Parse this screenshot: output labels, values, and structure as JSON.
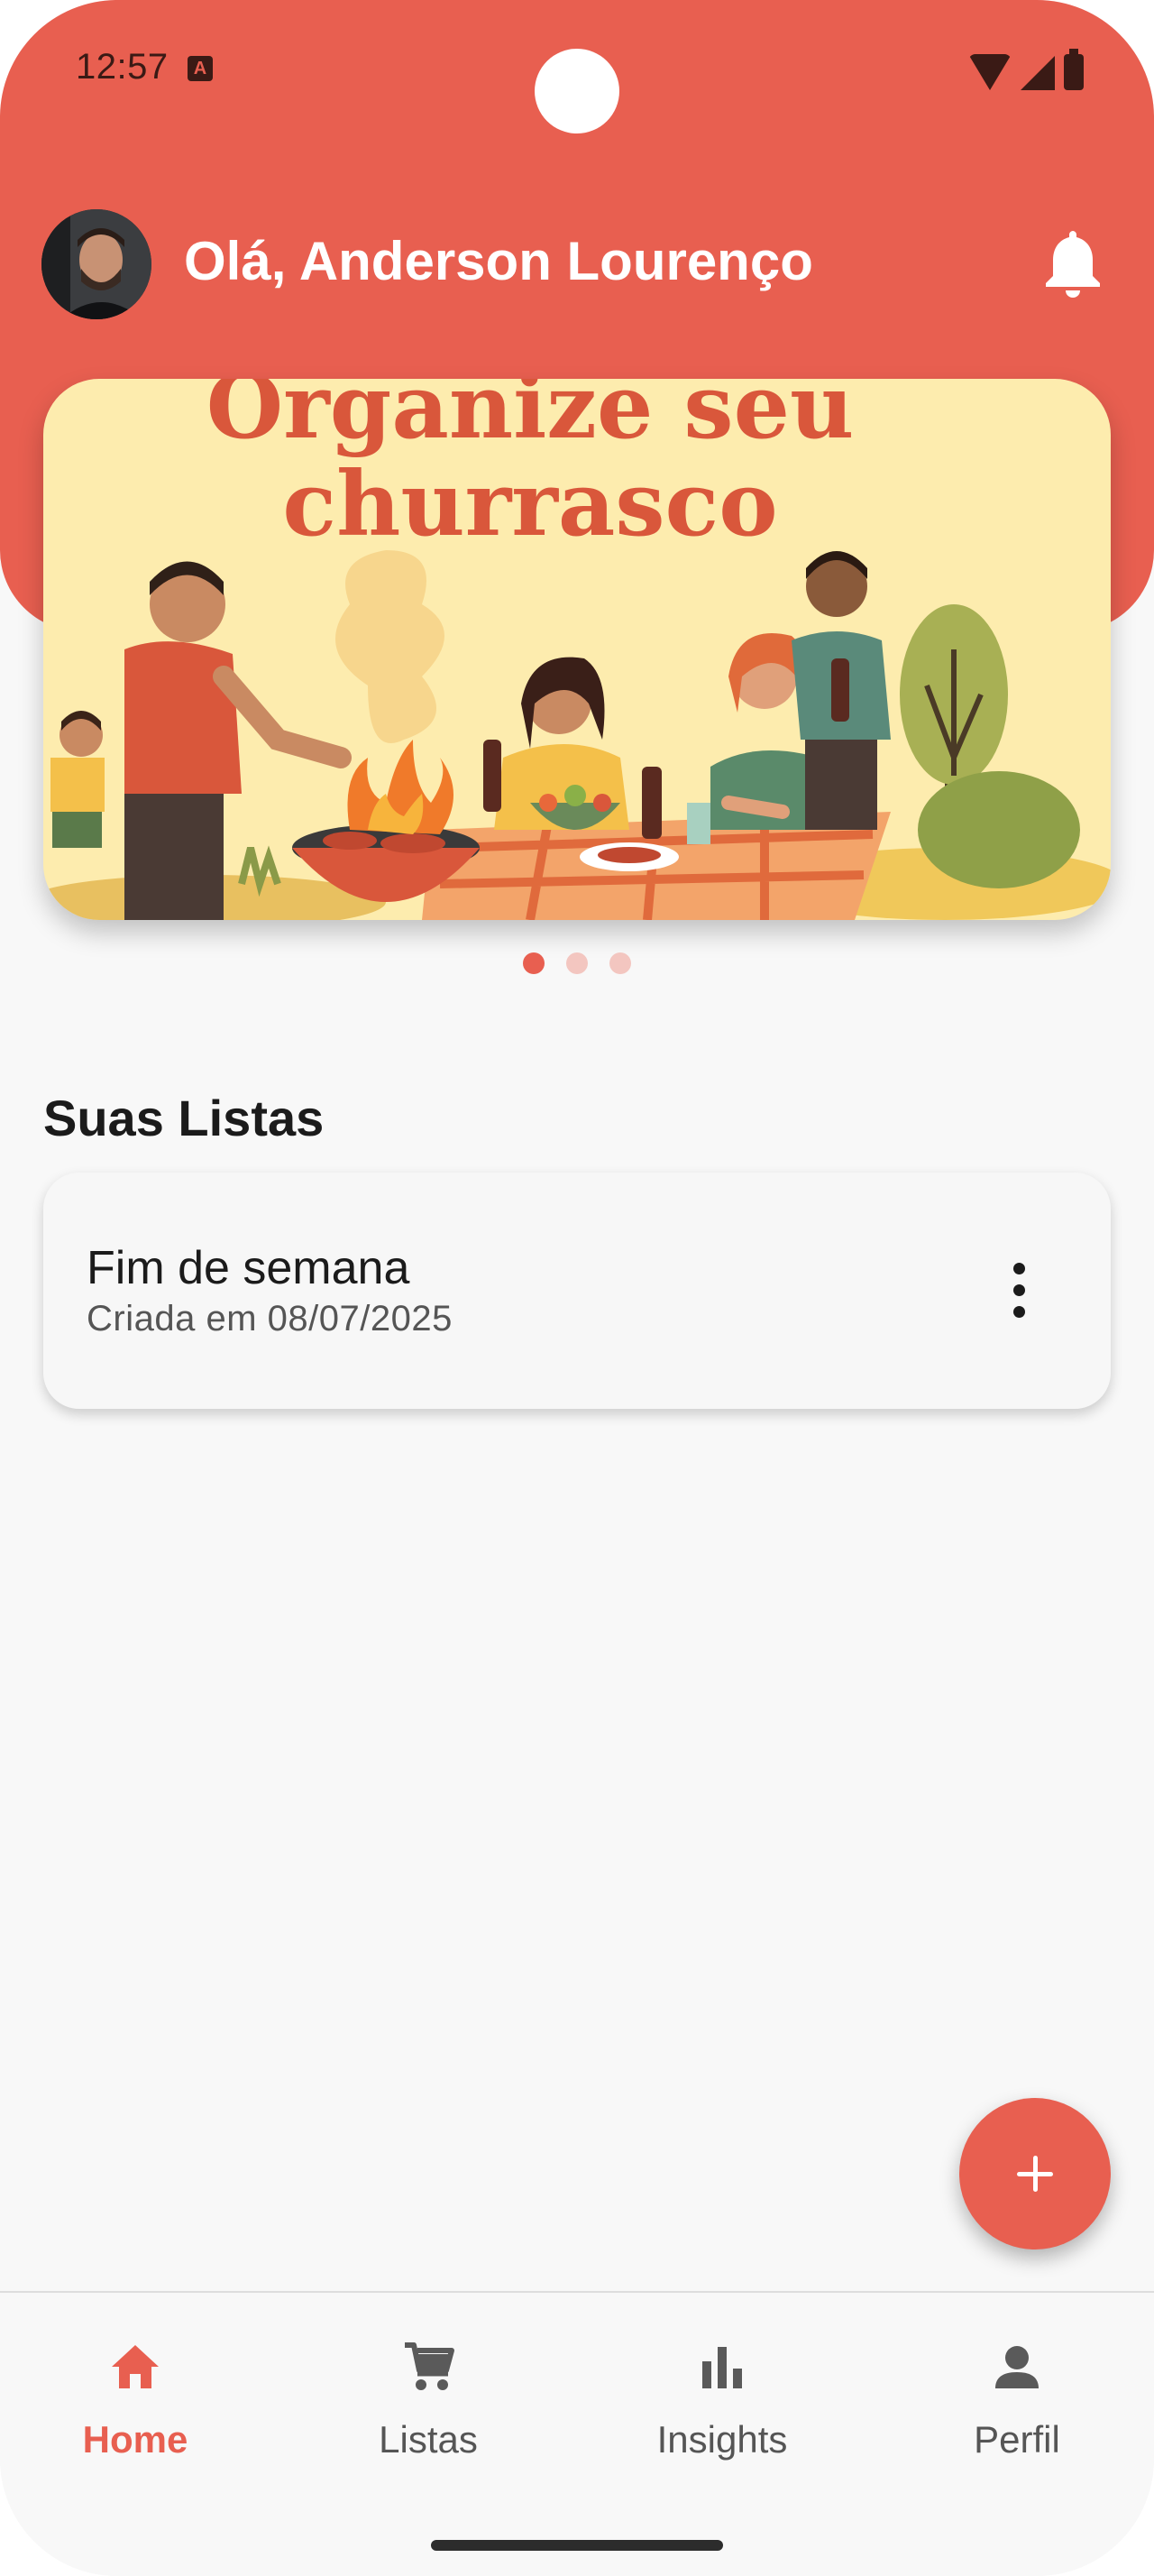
{
  "status_bar": {
    "time": "12:57"
  },
  "header": {
    "greeting": "Olá, Anderson Lourenço"
  },
  "banner": {
    "title_line1": "Organize seu",
    "title_line2": "churrasco",
    "slides": 3,
    "active_slide": 1
  },
  "lists_section": {
    "title": "Suas Listas",
    "items": [
      {
        "name": "Fim de semana",
        "created": "Criada em 08/07/2025"
      }
    ]
  },
  "bottom_nav": {
    "items": [
      {
        "label": "Home",
        "icon": "home-icon",
        "active": true
      },
      {
        "label": "Listas",
        "icon": "cart-icon",
        "active": false
      },
      {
        "label": "Insights",
        "icon": "bar-chart-icon",
        "active": false
      },
      {
        "label": "Perfil",
        "icon": "person-icon",
        "active": false
      }
    ]
  },
  "colors": {
    "primary": "#e85f50",
    "banner_bg": "#fdecae",
    "banner_title": "#d9573b"
  }
}
